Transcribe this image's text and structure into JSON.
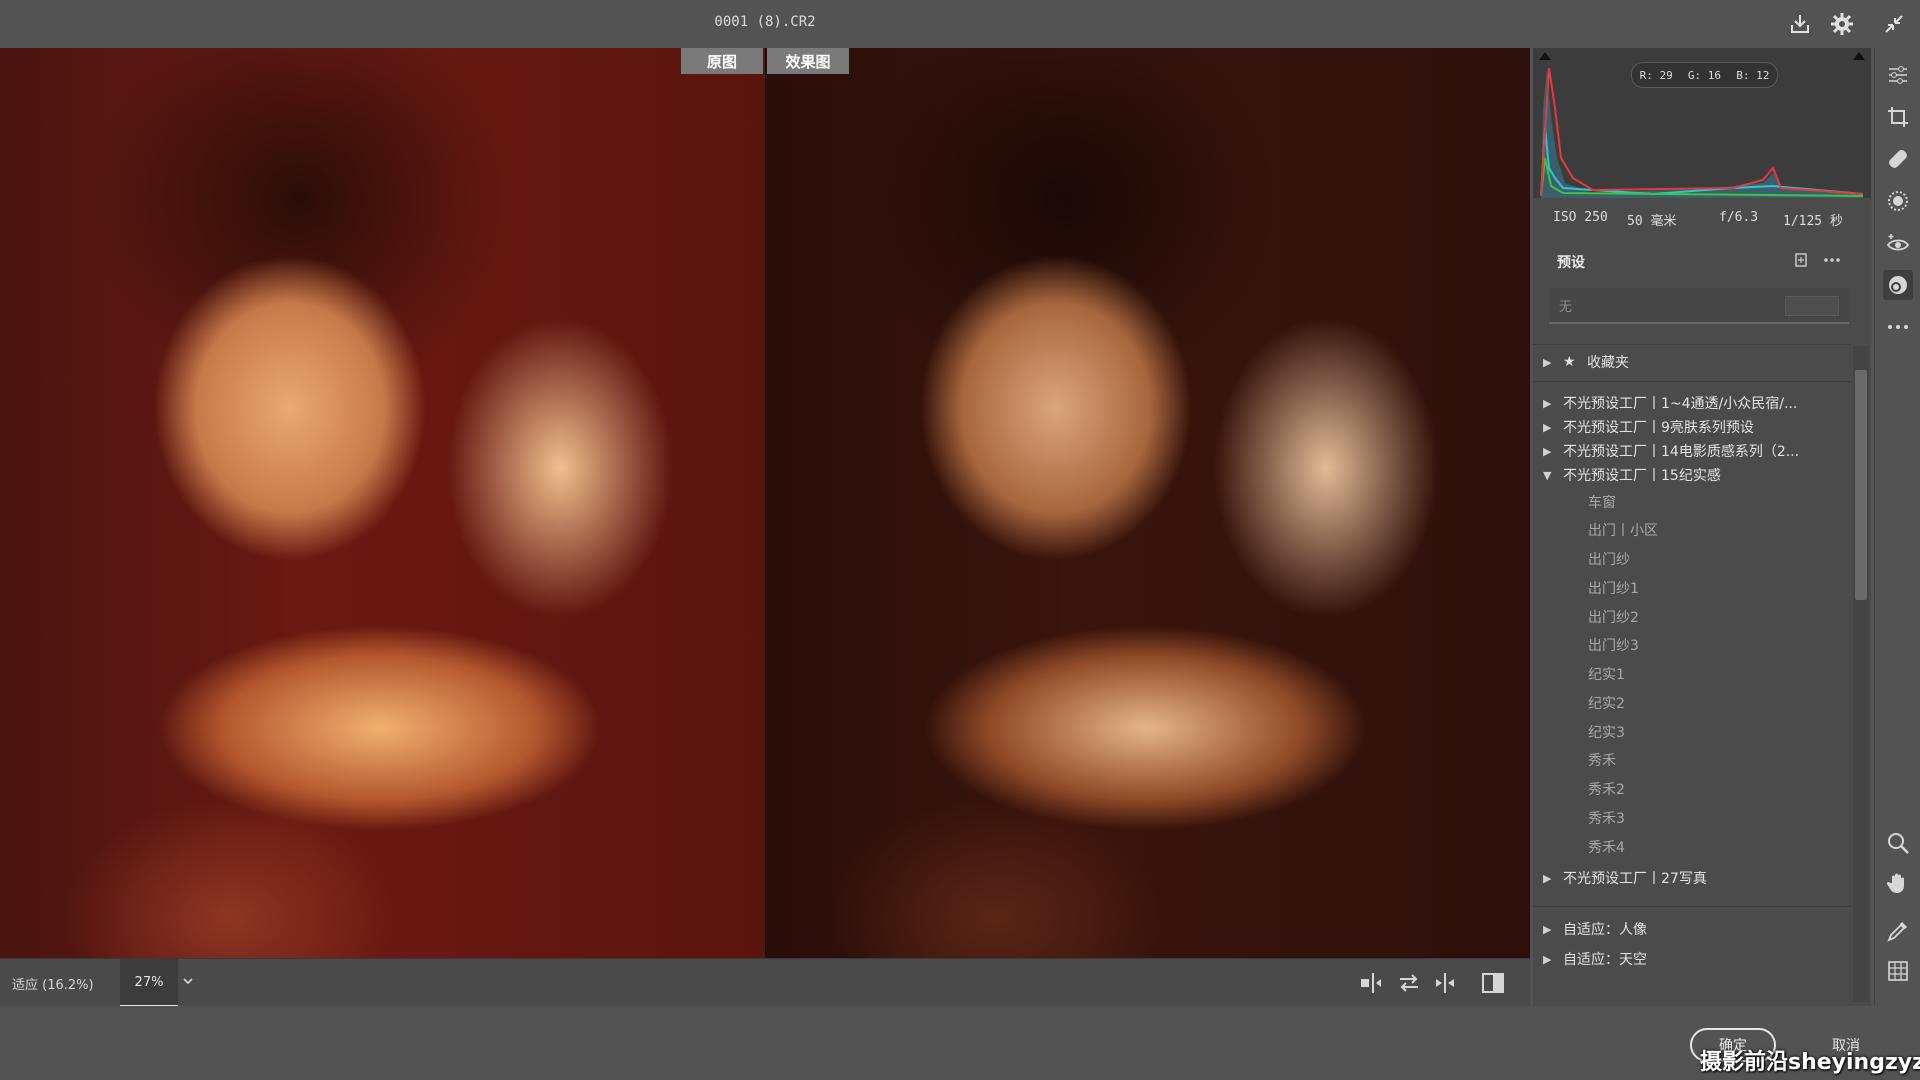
{
  "window": {
    "file_title": "0001 (8).CR2"
  },
  "compare": {
    "before_label": "原图",
    "after_label": "效果图"
  },
  "zoom": {
    "fit_label": "适应 (16.2%)",
    "value": "27%"
  },
  "histogram": {
    "r": "R: 29",
    "g": "G: 16",
    "b": "B: 12"
  },
  "exif": {
    "iso": "ISO 250",
    "focal": "50 毫米",
    "aperture": "f/6.3",
    "shutter": "1/125 秒"
  },
  "presets": {
    "title": "预设",
    "search_placeholder": "无",
    "favorites": "收藏夹",
    "groups": [
      {
        "label": "不光预设工厂丨1~4通透/小众民宿/..."
      },
      {
        "label": "不光预设工厂丨9亮肤系列预设"
      },
      {
        "label": "不光预设工厂丨14电影质感系列（2..."
      },
      {
        "label": "不光预设工厂丨15纪实感"
      }
    ],
    "children": [
      "车窗",
      "出门丨小区",
      "出门纱",
      "出门纱1",
      "出门纱2",
      "出门纱3",
      "纪实1",
      "纪实2",
      "纪实3",
      "秀禾",
      "秀禾2",
      "秀禾3",
      "秀禾4"
    ],
    "group_after": "不光预设工厂丨27写真",
    "adaptive": [
      {
        "label": "自适应：人像"
      },
      {
        "label": "自适应：天空"
      }
    ]
  },
  "footer": {
    "ok_label": "确定",
    "cancel_label": "取消"
  },
  "watermark": "摄影前沿sheyingzyz.com",
  "colors": {
    "accent": "#e8e8e8",
    "panel": "#4b4b4b",
    "canvas_bg": "#1c0c08"
  }
}
